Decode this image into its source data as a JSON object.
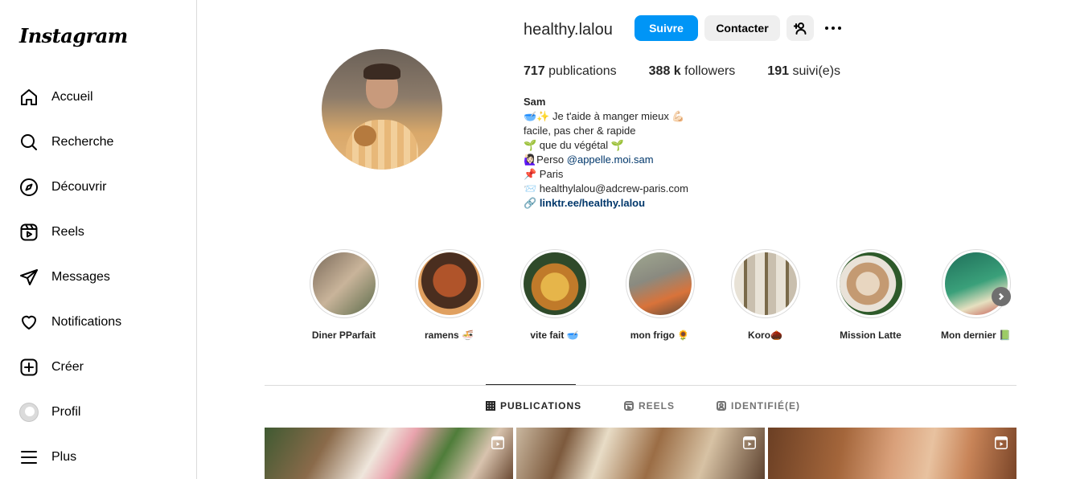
{
  "sidebar": {
    "logo": "Instagram",
    "items": [
      {
        "label": "Accueil",
        "icon": "home-icon"
      },
      {
        "label": "Recherche",
        "icon": "search-icon"
      },
      {
        "label": "Découvrir",
        "icon": "compass-icon"
      },
      {
        "label": "Reels",
        "icon": "reels-icon"
      },
      {
        "label": "Messages",
        "icon": "send-icon"
      },
      {
        "label": "Notifications",
        "icon": "heart-icon"
      },
      {
        "label": "Créer",
        "icon": "plus-square-icon"
      },
      {
        "label": "Profil",
        "icon": "avatar"
      },
      {
        "label": "Plus",
        "icon": "menu-icon"
      }
    ]
  },
  "profile": {
    "username": "healthy.lalou",
    "follow_label": "Suivre",
    "contact_label": "Contacter",
    "stats": {
      "posts_count": "717",
      "posts_label": "publications",
      "followers_count": "388 k",
      "followers_label": "followers",
      "following_count": "191",
      "following_label": "suivi(e)s"
    },
    "bio": {
      "name": "Sam",
      "line1": "🥣✨ Je t'aide à manger mieux 💪🏻",
      "line2": "facile, pas cher & rapide",
      "line3": "🌱 que du végétal 🌱",
      "line4_prefix": "🙋🏻‍♀️Perso ",
      "line4_mention": "@appelle.moi.sam",
      "line5": "📌 Paris",
      "line6": "📨 healthylalou@adcrew-paris.com",
      "link": "linktr.ee/healthy.lalou"
    }
  },
  "highlights": [
    {
      "label": "Diner PParfait",
      "colors": [
        "#7a6a5a",
        "#c9b49a",
        "#5b6b4a"
      ]
    },
    {
      "label": "ramens 🍜",
      "colors": [
        "#4a2e1f",
        "#b0542a",
        "#e0a060"
      ]
    },
    {
      "label": "vite fait 🥣",
      "colors": [
        "#2f4a2a",
        "#c07a2a",
        "#e6b54a"
      ]
    },
    {
      "label": "mon frigo 🌻",
      "colors": [
        "#8a8a80",
        "#d9733a",
        "#a0a890"
      ]
    },
    {
      "label": "Koro🌰",
      "colors": [
        "#e8e2d6",
        "#7a6a4a",
        "#c9bfae"
      ]
    },
    {
      "label": "Mission Latte",
      "colors": [
        "#2e5a2a",
        "#e8d6c0",
        "#c49a72"
      ]
    },
    {
      "label": "Mon dernier 📗",
      "colors": [
        "#1f6f5a",
        "#3aa07a",
        "#e6e0c0"
      ]
    }
  ],
  "tabs": [
    {
      "label": "PUBLICATIONS",
      "icon": "grid-icon",
      "active": true
    },
    {
      "label": "REELS",
      "icon": "reels-icon",
      "active": false
    },
    {
      "label": "IDENTIFIÉ(E)",
      "icon": "tagged-icon",
      "active": false
    }
  ],
  "accent_color": "#0095f6"
}
